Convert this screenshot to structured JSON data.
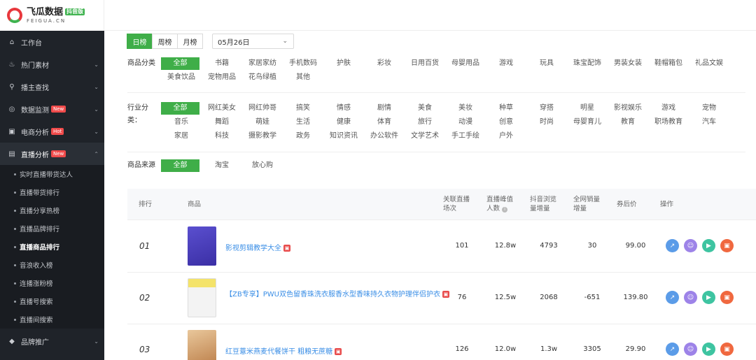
{
  "brand": {
    "title": "飞瓜数据",
    "tag": "抖音版",
    "sub": "FEIGUA.CN"
  },
  "sidebar": {
    "items": [
      {
        "label": "工作台",
        "icon": "home-icon"
      },
      {
        "label": "热门素材",
        "icon": "fire-icon"
      },
      {
        "label": "播主查找",
        "icon": "search-icon"
      },
      {
        "label": "数据监测",
        "icon": "monitor-icon",
        "badge": "New"
      },
      {
        "label": "电商分析",
        "icon": "cart-icon",
        "badge": "Hot"
      },
      {
        "label": "直播分析",
        "icon": "live-icon",
        "badge": "New"
      }
    ],
    "sub_items": [
      "实时直播带货达人",
      "直播带货排行",
      "直播分享热榜",
      "直播品牌排行",
      "直播商品排行",
      "音浪收入榜",
      "连播涨粉榜",
      "直播号搜索",
      "直播间搜索"
    ],
    "bottom_item": {
      "label": "品牌推广",
      "icon": "diamond-icon"
    }
  },
  "period": {
    "tabs": [
      "日榜",
      "周榜",
      "月榜"
    ],
    "date": "05月26日"
  },
  "filters": {
    "product_category": {
      "label": "商品分类",
      "items": [
        "全部",
        "书籍",
        "家居家纺",
        "手机数码",
        "护肤",
        "彩妆",
        "日用百货",
        "母婴用品",
        "游戏",
        "玩具",
        "珠宝配饰",
        "男装女装",
        "鞋帽箱包",
        "礼品文娱",
        "美食饮品",
        "宠物用品",
        "花鸟绿植",
        "其他"
      ]
    },
    "industry_category": {
      "label": "行业分类：",
      "items": [
        "全部",
        "网红美女",
        "网红帅哥",
        "搞笑",
        "情感",
        "剧情",
        "美食",
        "美妆",
        "种草",
        "穿搭",
        "明星",
        "影视娱乐",
        "游戏",
        "宠物",
        "音乐",
        "舞蹈",
        "萌娃",
        "生活",
        "健康",
        "体育",
        "旅行",
        "动漫",
        "创意",
        "时尚",
        "母婴育儿",
        "教育",
        "职场教育",
        "汽车",
        "家居",
        "科技",
        "摄影教学",
        "政务",
        "知识资讯",
        "办公软件",
        "文学艺术",
        "手工手绘",
        "户外"
      ]
    },
    "product_source": {
      "label": "商品来源",
      "items": [
        "全部",
        "淘宝",
        "放心购"
      ]
    }
  },
  "table": {
    "headers": {
      "rank": "排行",
      "product": "商品",
      "sessions_l1": "关联直播",
      "sessions_l2": "场次",
      "peak_l1": "直播峰值",
      "peak_l2": "人数",
      "views_l1": "抖音浏览",
      "views_l2": "量增量",
      "sales_l1": "全网销量",
      "sales_l2": "增量",
      "price": "券后价",
      "ops": "操作"
    },
    "rows": [
      {
        "rank": "01",
        "name": "影视剪辑教学大全",
        "sessions": "101",
        "peak": "12.8w",
        "views": "4793",
        "sales": "30",
        "price": "99.00"
      },
      {
        "rank": "02",
        "name": "【ZB专享】PWU双色留香珠洗衣服香水型香味持久衣物护理伴侣护衣",
        "sessions": "76",
        "peak": "12.5w",
        "views": "2068",
        "sales": "-651",
        "price": "139.80"
      },
      {
        "rank": "03",
        "name": "红豆薏米燕麦代餐饼干 粗粮无蔗糖",
        "sessions": "126",
        "peak": "12.0w",
        "views": "1.3w",
        "sales": "3305",
        "price": "29.90"
      }
    ]
  },
  "colors": {
    "accent": "#3fae48",
    "sidebar_bg": "#1f2329",
    "link": "#3a8ee6"
  }
}
